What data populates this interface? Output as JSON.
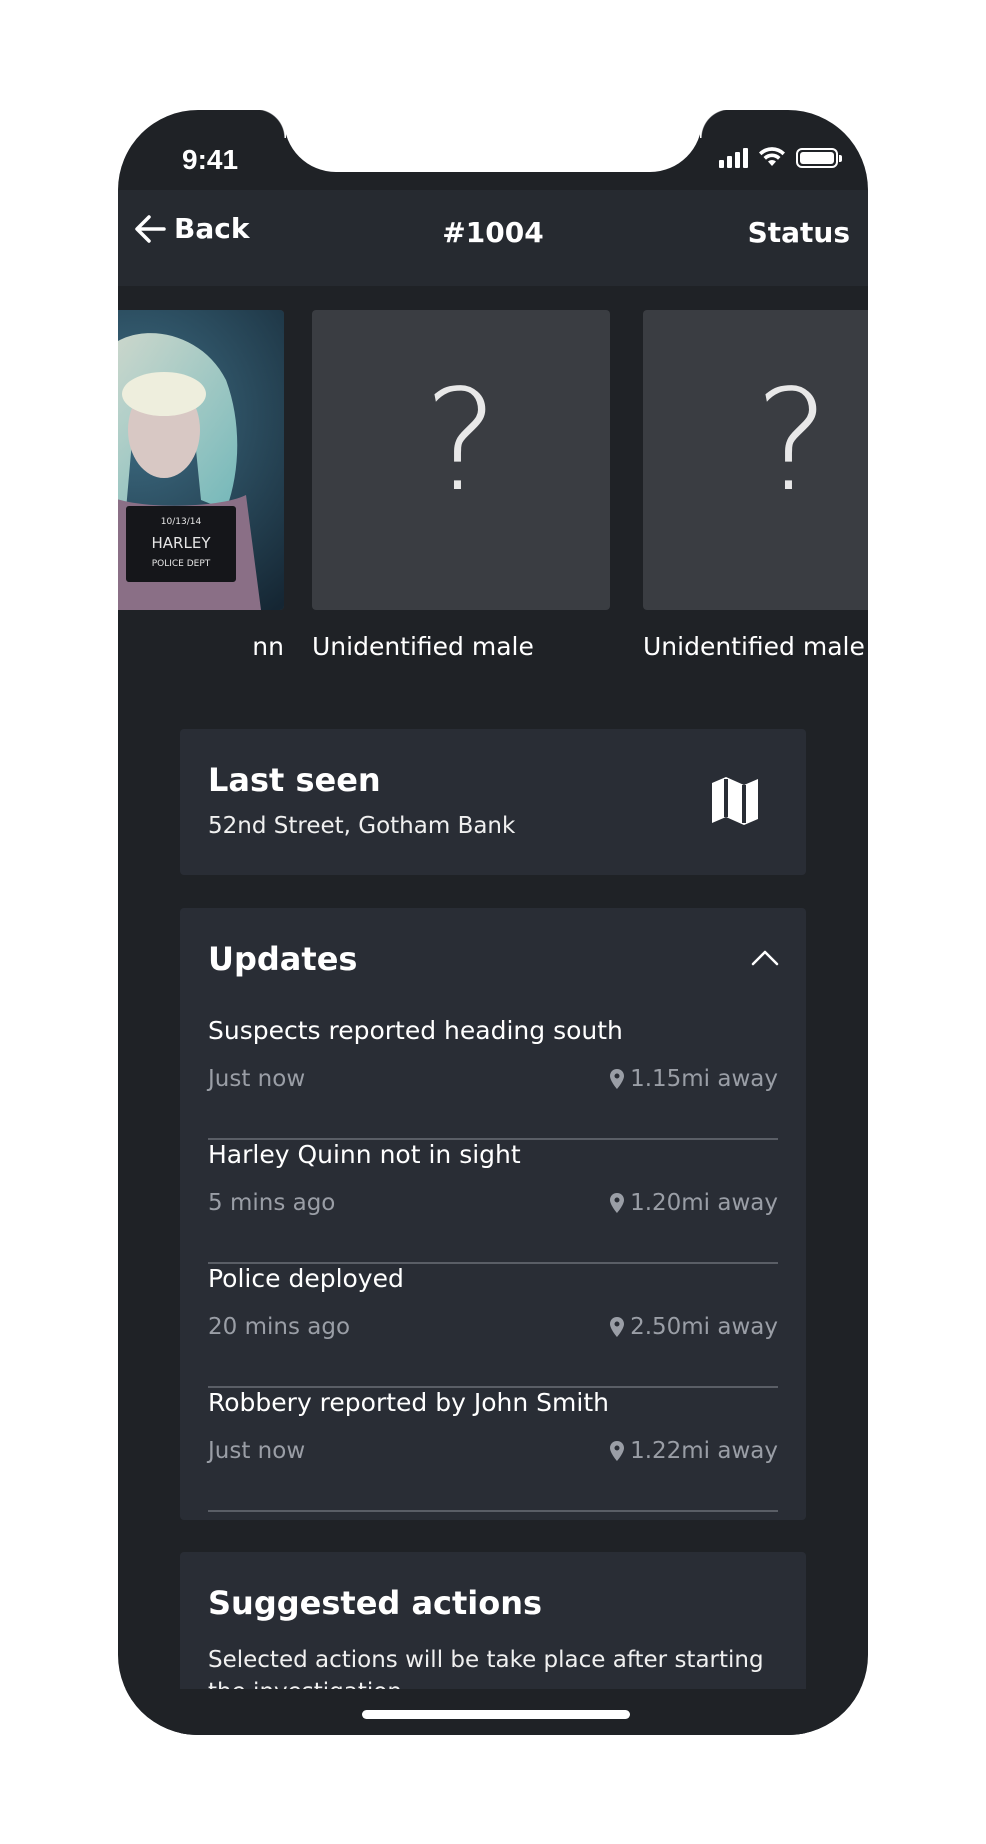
{
  "status_bar": {
    "time": "9:41",
    "icons": [
      "signal-icon",
      "wifi-icon",
      "battery-icon"
    ]
  },
  "nav": {
    "back_label": "Back",
    "title": "#1004",
    "status_label": "Status"
  },
  "suspects": [
    {
      "caption": "nn",
      "photo": "mugshot-photo",
      "mugshot_text": [
        "10/13/14",
        "HARLEY",
        "POLICE DEPT"
      ]
    },
    {
      "caption": "Unidentified male",
      "placeholder": "?"
    },
    {
      "caption": "Unidentified male",
      "placeholder": "?"
    }
  ],
  "last_seen": {
    "title": "Last seen",
    "location": "52nd Street, Gotham Bank",
    "icon": "map-icon"
  },
  "updates": {
    "title": "Updates",
    "items": [
      {
        "text": "Suspects reported heading south",
        "time": "Just now",
        "distance": "1.15mi away"
      },
      {
        "text": "Harley Quinn not in sight",
        "time": "5 mins ago",
        "distance": "1.20mi away"
      },
      {
        "text": "Police deployed",
        "time": "20 mins ago",
        "distance": "2.50mi away"
      },
      {
        "text": "Robbery reported by John Smith",
        "time": "Just now",
        "distance": "1.22mi away"
      }
    ]
  },
  "suggested_actions": {
    "title": "Suggested actions",
    "description": "Selected actions will be take place after starting the investigation"
  }
}
